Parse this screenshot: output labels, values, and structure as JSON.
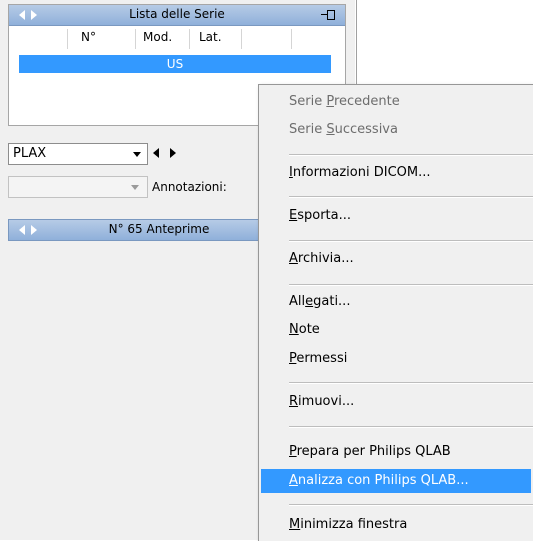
{
  "series_panel": {
    "title": "Lista delle Serie",
    "columns": [
      "N°",
      "Mod.",
      "Lat."
    ],
    "rows": [
      {
        "mod": "US"
      }
    ]
  },
  "view_select": {
    "value": "PLAX"
  },
  "annotations": {
    "label": "Annotazioni:"
  },
  "thumbnails": {
    "title": "N° 65 Anteprime"
  },
  "context_menu": {
    "items": [
      {
        "pre": "Serie ",
        "ul": "P",
        "post": "recedente",
        "disabled": true
      },
      {
        "pre": "Serie ",
        "ul": "S",
        "post": "uccessiva",
        "disabled": true
      },
      {
        "pre": "",
        "ul": "I",
        "post": "nformazioni DICOM...",
        "disabled": false
      },
      {
        "pre": "",
        "ul": "E",
        "post": "sporta...",
        "disabled": false
      },
      {
        "pre": "",
        "ul": "A",
        "post": "rchivia...",
        "disabled": false
      },
      {
        "pre": "All",
        "ul": "e",
        "post": "gati...",
        "disabled": false
      },
      {
        "pre": "",
        "ul": "N",
        "post": "ote",
        "disabled": false
      },
      {
        "pre": "",
        "ul": "P",
        "post": "ermessi",
        "disabled": false
      },
      {
        "pre": "",
        "ul": "R",
        "post": "imuovi...",
        "disabled": false
      },
      {
        "pre": "",
        "ul": "P",
        "post": "repara per Philips QLAB",
        "disabled": false
      },
      {
        "pre": "",
        "ul": "A",
        "post": "nalizza con Philips QLAB...",
        "disabled": false,
        "highlighted": true
      },
      {
        "pre": "",
        "ul": "M",
        "post": "inimizza finestra",
        "disabled": false
      }
    ]
  },
  "colors": {
    "highlight": "#3399ff",
    "titlebar": "#9fbce0"
  }
}
